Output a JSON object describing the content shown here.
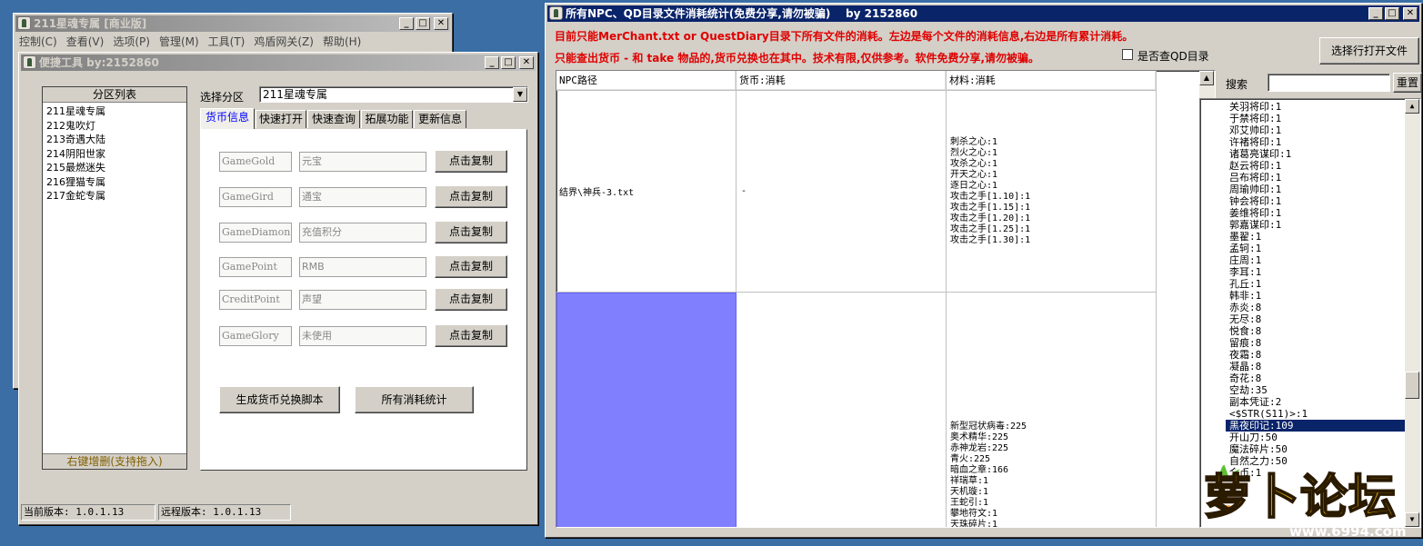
{
  "win1": {
    "title": "211星魂专属 [商业版]",
    "menu": [
      "控制(C)",
      "查看(V)",
      "选项(P)",
      "管理(M)",
      "工具(T)",
      "鸡盾网关(Z)",
      "帮助(H)"
    ]
  },
  "win2": {
    "title": "便捷工具  by:2152860",
    "partition_header": "分区列表",
    "partitions": [
      "211星魂专属",
      "212鬼吹灯",
      "213奇遇大陆",
      "214阴阳世家",
      "215最燃迷失",
      "216狸猫专属",
      "217金蛇专属"
    ],
    "partition_footer": "右键增删(支持拖入)",
    "select_label": "选择分区",
    "select_value": "211星魂专属",
    "tabs": [
      "货币信息",
      "快速打开",
      "快速查询",
      "拓展功能",
      "更新信息"
    ],
    "currency_rows": [
      {
        "field": "GameGold",
        "name": "元宝",
        "button": "点击复制"
      },
      {
        "field": "GameGird",
        "name": "通宝",
        "button": "点击复制"
      },
      {
        "field": "GameDiamond",
        "name": "充值积分",
        "button": "点击复制"
      },
      {
        "field": "GamePoint",
        "name": "RMB",
        "button": "点击复制"
      },
      {
        "field": "CreditPoint",
        "name": "声望",
        "button": "点击复制"
      },
      {
        "field": "GameGlory",
        "name": "未使用",
        "button": "点击复制"
      }
    ],
    "gen_script_button": "生成货币兑换脚本",
    "all_stats_button": "所有消耗统计",
    "current_version": "当前版本: 1.0.1.13",
    "remote_version": "远程版本: 1.0.1.13"
  },
  "win3": {
    "title": "所有NPC、QD目录文件消耗统计(免费分享,请勿被骗)    by 2152860",
    "notice1": "目前只能MerChant.txt or QuestDiary目录下所有文件的消耗。左边是每个文件的消耗信息,右边是所有累计消耗。",
    "notice2": "只能查出货币 - 和 take 物品的,货币兑换也在其中。技术有限,仅供参考。软件免费分享,请勿被骗。",
    "checkbox_label": "是否查QD目录",
    "open_file_button": "选择行打开文件",
    "search_label": "搜索",
    "reset_button": "重置",
    "columns": [
      "NPC路径",
      "货币:消耗",
      "材料:消耗"
    ],
    "rows": [
      {
        "path": "结界\\神兵-3.txt",
        "currency": "-",
        "materials": [
          "刺杀之心:1",
          "烈火之心:1",
          "攻杀之心:1",
          "开天之心:1",
          "逐日之心:1",
          "攻击之手[1.10]:1",
          "攻击之手[1.15]:1",
          "攻击之手[1.20]:1",
          "攻击之手[1.25]:1",
          "攻击之手[1.30]:1"
        ]
      },
      {
        "path": "",
        "currency": "",
        "materials": [
          "新型冠状病毒:225",
          "奥术精华:225",
          "赤神龙岩:225",
          "青火:225",
          "暗血之章:166",
          "祥瑞草:1",
          "天机璇:1",
          "王蛇引:1",
          "攀地符文:1",
          "天珠碎片:1"
        ]
      }
    ],
    "totals": [
      "关羽将印:1",
      "于禁将印:1",
      "邓艾帅印:1",
      "许褚将印:1",
      "诸葛亮谋印:1",
      "赵云将印:1",
      "吕布将印:1",
      "周瑜帅印:1",
      "钟会将印:1",
      "姜维将印:1",
      "郭嘉谋印:1",
      "墨翟:1",
      "孟轲:1",
      "庄周:1",
      "李耳:1",
      "孔丘:1",
      "韩非:1",
      "赤炎:8",
      "无尽:8",
      "悦食:8",
      "留痕:8",
      "夜霜:8",
      "凝晶:8",
      "奇花:8",
      "空劫:35",
      "副本凭证:2",
      "<$STR(S11)>:1",
      "黑夜印记:109",
      "开山刀:50",
      "魔法碎片:50",
      "自然之力:50",
      "金币:1"
    ],
    "selected_total": "黑夜印记:109"
  },
  "watermark": {
    "text": "萝卜论坛",
    "url": "www.6994.com"
  },
  "colors": {
    "desktop": "#3a6ea5",
    "title_active": "#0a246a",
    "notice": "#e00000",
    "selected_cell": "#8080ff",
    "selection": "#0a246a"
  }
}
